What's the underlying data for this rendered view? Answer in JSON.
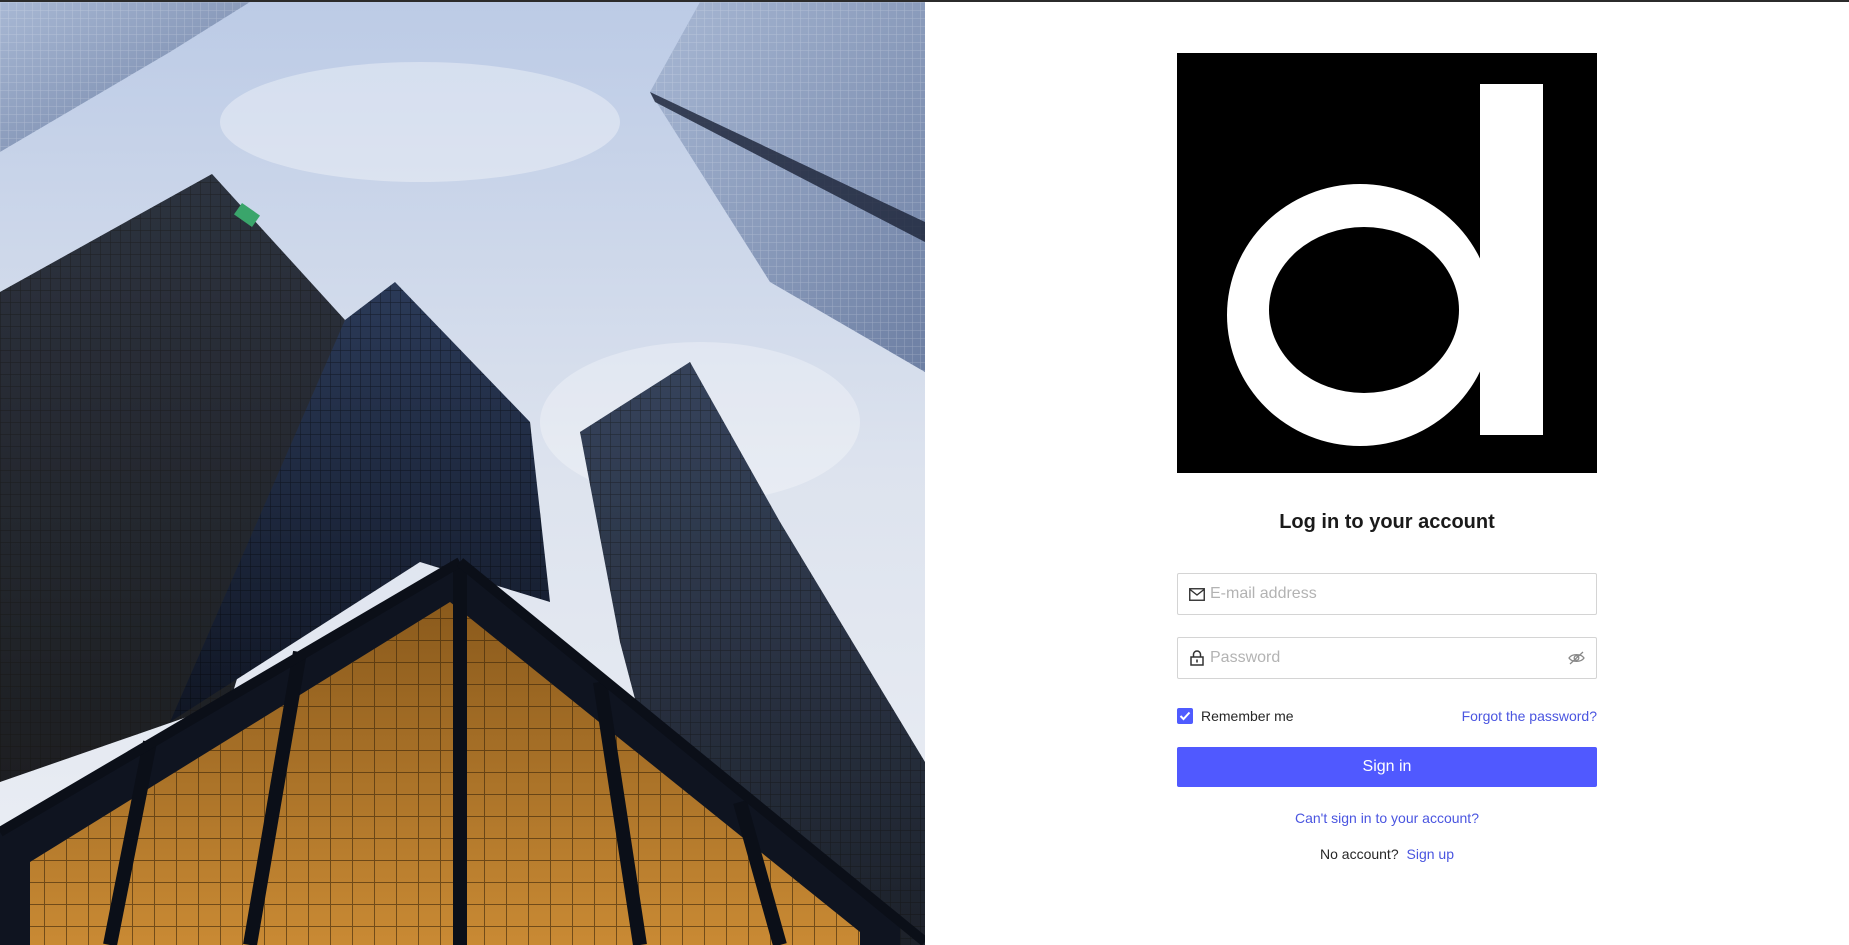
{
  "login": {
    "heading": "Log in to your account",
    "email_placeholder": "E-mail address",
    "password_placeholder": "Password",
    "remember_label": "Remember me",
    "remember_checked": true,
    "forgot_label": "Forgot the password?",
    "signin_label": "Sign in",
    "cant_signin_label": "Can't sign in to your account?",
    "no_account_text": "No account?",
    "signup_label": "Sign up"
  },
  "icons": {
    "email": "envelope-icon",
    "password": "lock-icon",
    "visibility": "eye-slash-icon",
    "checkbox": "check-icon"
  },
  "colors": {
    "accent": "#5059ff",
    "link": "#4a55e0",
    "logo_bg": "#000000",
    "logo_fg": "#ffffff"
  }
}
